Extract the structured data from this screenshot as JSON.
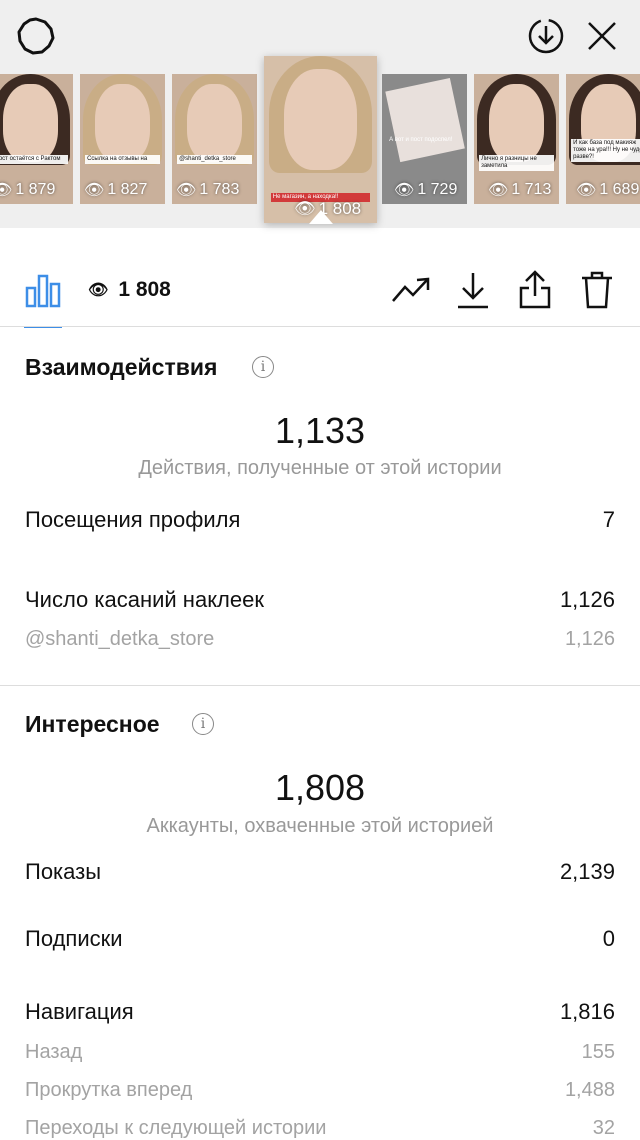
{
  "header": {
    "stories": [
      {
        "views": "1 879",
        "caption": "Рост остаётся с Рактом",
        "style": "dark"
      },
      {
        "views": "1 827",
        "caption": "Ссылка на отзывы на",
        "style": "blonde"
      },
      {
        "views": "1 783",
        "caption": "@shanti_detka_store",
        "style": "blonde"
      },
      {
        "views": "1 808",
        "caption": "Не магазин, а находка!!",
        "style": "blonde",
        "selected": true
      },
      {
        "views": "1 729",
        "caption": "А вот и пост подоспел!",
        "style": "note"
      },
      {
        "views": "1 713",
        "caption": "Лично я разницы не заметила",
        "style": "dark"
      },
      {
        "views": "1 689",
        "caption": "И как база под макияж тоже на ура!!! Ну не чудо разве?!",
        "style": "dark"
      }
    ]
  },
  "toolbar": {
    "views": "1 808"
  },
  "interactions": {
    "title": "Взаимодействия",
    "total": "1,133",
    "total_label": "Действия, полученные от этой истории",
    "rows": [
      {
        "label": "Посещения профиля",
        "value": "7"
      },
      {
        "label": "Число касаний наклеек",
        "value": "1,126"
      }
    ],
    "sub_rows": [
      {
        "label": "@shanti_detka_store",
        "value": "1,126"
      }
    ]
  },
  "discovery": {
    "title": "Интересное",
    "total": "1,808",
    "total_label": "Аккаунты, охваченные этой историей",
    "rows": [
      {
        "label": "Показы",
        "value": "2,139"
      },
      {
        "label": "Подписки",
        "value": "0"
      },
      {
        "label": "Навигация",
        "value": "1,816"
      }
    ],
    "sub_rows": [
      {
        "label": "Назад",
        "value": "155"
      },
      {
        "label": "Прокрутка вперед",
        "value": "1,488"
      },
      {
        "label": "Переходы к следующей истории",
        "value": "32"
      }
    ]
  }
}
